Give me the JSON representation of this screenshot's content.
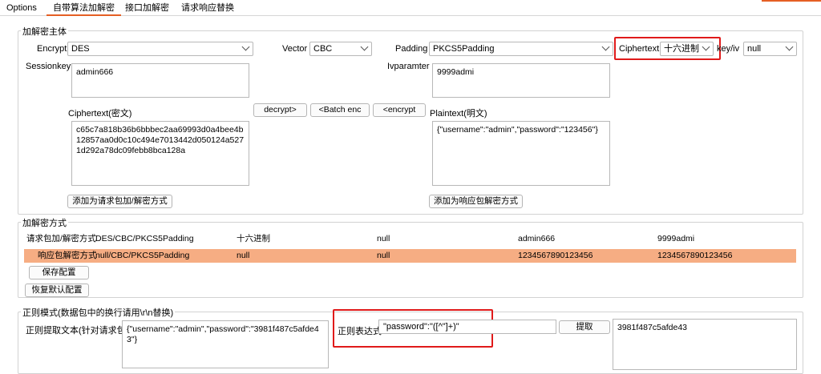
{
  "tabs": [
    {
      "label": "Options"
    },
    {
      "label": "自带算法加解密"
    },
    {
      "label": "接口加解密"
    },
    {
      "label": "请求响应替换"
    }
  ],
  "crypto": {
    "group_title": "加解密主体",
    "encrypt_label": "Encrypt",
    "encrypt_value": "DES",
    "vector_label": "Vector",
    "vector_value": "CBC",
    "padding_label": "Padding",
    "padding_value": "PKCS5Padding",
    "ciphertext_fmt_label": "Ciphertext",
    "ciphertext_fmt_value": "十六进制",
    "keyiv_label": "key/iv",
    "keyiv_value": "null",
    "sessionkey_label": "Sessionkey",
    "sessionkey_value": "admin666",
    "ivparamter_label": "Ivparamter",
    "ivparamter_value": "9999admi",
    "ciphertext_label": "Ciphertext(密文)",
    "ciphertext_value": "c65c7a818b36b6bbbec2aa69993d0a4bee4b12857aa0d0c10c494e7013442d050124a5271d292a78dc09febb8bca128a",
    "plaintext_label": "Plaintext(明文)",
    "plaintext_value": "{\"username\":\"admin\",\"password\":\"123456\"}",
    "decrypt_button": "decrypt>",
    "batch_enc_button": "<Batch enc",
    "encrypt_button": "<encrypt",
    "add_request_button": "添加为请求包加/解密方式",
    "add_response_button": "添加为响应包解密方式"
  },
  "modes": {
    "group_title": "加解密方式",
    "rows": [
      {
        "label": "请求包加/解密方式",
        "cells": [
          "DES/CBC/PKCS5Padding",
          "十六进制",
          "null",
          "admin666",
          "9999admi"
        ]
      },
      {
        "label": "响应包解密方式",
        "cells": [
          "null/CBC/PKCS5Padding",
          "null",
          "null",
          "1234567890123456",
          "1234567890123456"
        ]
      }
    ],
    "save_button": "保存配置",
    "restore_button": "恢复默认配置"
  },
  "regex": {
    "group_title": "正则模式(数据包中的换行请用\\r\\n替换)",
    "extract_label": "正则提取文本(针对请求包)",
    "extract_value": "{\"username\":\"admin\",\"password\":\"3981f487c5afde43\"}",
    "expr_label": "正则表达式",
    "expr_value": "\"password\":\"([^\"]+)\"",
    "extract_button": "提取",
    "result_value": "3981f487c5afde43"
  }
}
